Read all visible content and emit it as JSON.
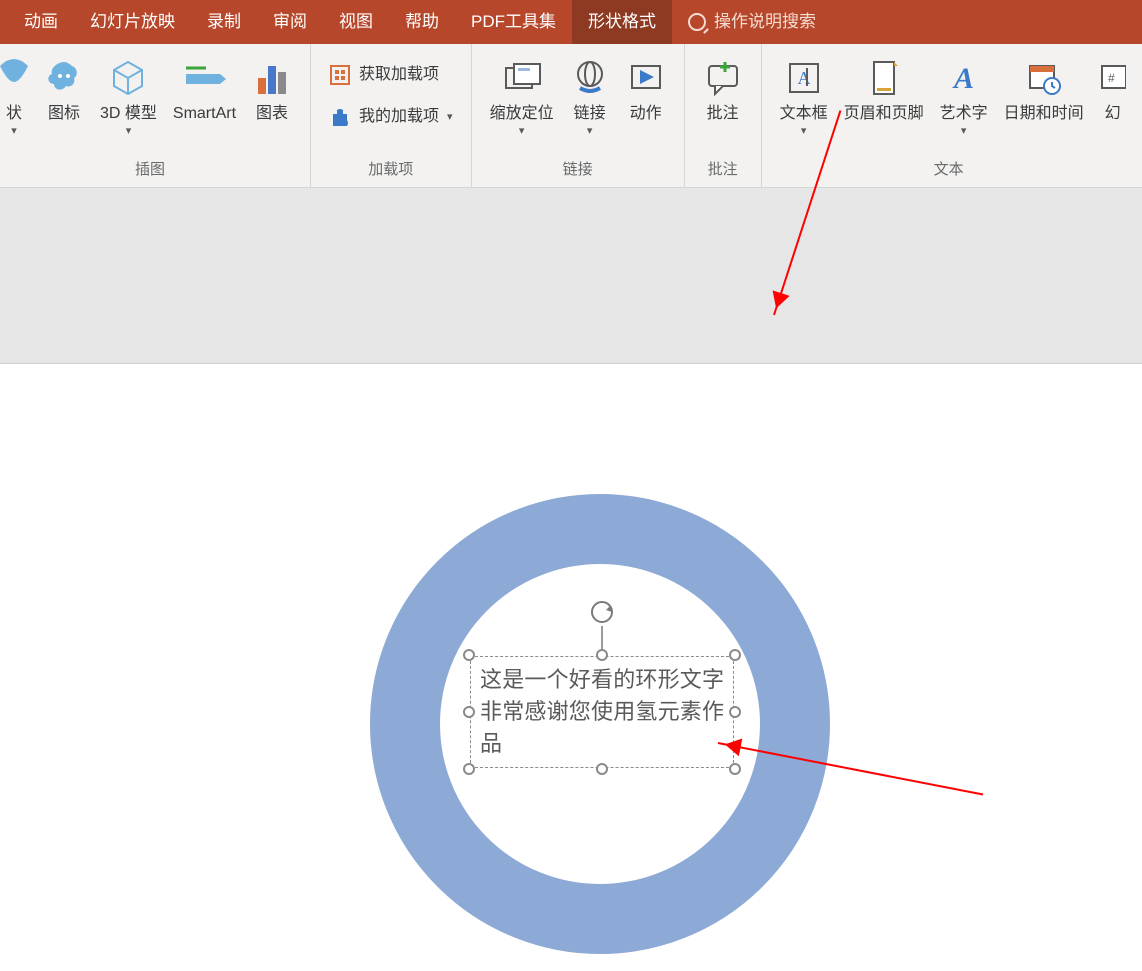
{
  "tabs": {
    "items": [
      {
        "label": "动画"
      },
      {
        "label": "幻灯片放映"
      },
      {
        "label": "录制"
      },
      {
        "label": "审阅"
      },
      {
        "label": "视图"
      },
      {
        "label": "帮助"
      },
      {
        "label": "PDF工具集"
      },
      {
        "label": "形状格式"
      }
    ],
    "active_index": 7,
    "tell_me": "操作说明搜索"
  },
  "ribbon": {
    "groups": {
      "illustrations": {
        "label": "插图",
        "controls": {
          "shapes": "状",
          "icons": "图标",
          "model3d": "3D 模型",
          "smartart": "SmartArt",
          "chart": "图表"
        }
      },
      "addins": {
        "label": "加载项",
        "get": "获取加载项",
        "my": "我的加载项"
      },
      "links": {
        "label": "链接",
        "zoom": "缩放定位",
        "link": "链接",
        "action": "动作"
      },
      "comments": {
        "label": "批注",
        "comment": "批注"
      },
      "text": {
        "label": "文本",
        "textbox": "文本框",
        "headerfooter": "页眉和页脚",
        "wordart": "艺术字",
        "datetime": "日期和时间",
        "slidenum": "幻"
      }
    }
  },
  "slide": {
    "textbox_content": "这是一个好看的环形文字非常感谢您使用氢元素作品",
    "donut_color": "#8da9d5"
  }
}
